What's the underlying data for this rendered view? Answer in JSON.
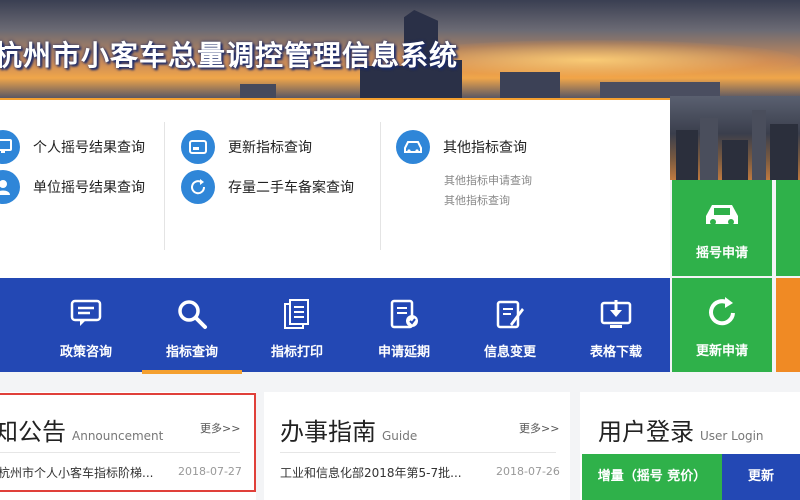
{
  "header": {
    "title": "杭州市小客车总量调控管理信息系统"
  },
  "query": {
    "col1": [
      {
        "label": "个人摇号结果查询",
        "icon": "monitor-icon"
      },
      {
        "label": "单位摇号结果查询",
        "icon": "user-icon"
      }
    ],
    "col2": [
      {
        "label": "更新指标查询",
        "icon": "card-icon"
      },
      {
        "label": "存量二手车备案查询",
        "icon": "refresh-icon"
      }
    ],
    "col3": {
      "label": "其他指标查询",
      "icon": "car-icon",
      "subs": [
        "其他指标申请查询",
        "其他指标查询"
      ]
    }
  },
  "nav": [
    {
      "label": "政策咨询",
      "icon": "chat-icon"
    },
    {
      "label": "指标查询",
      "icon": "search-icon",
      "active": true
    },
    {
      "label": "指标打印",
      "icon": "document-icon"
    },
    {
      "label": "申请延期",
      "icon": "form-edit-icon"
    },
    {
      "label": "信息变更",
      "icon": "edit-icon"
    },
    {
      "label": "表格下载",
      "icon": "download-icon"
    }
  ],
  "tiles": {
    "lottery": "摇号申请",
    "renew": "更新申请"
  },
  "announcement": {
    "title": "知公告",
    "sub": "Announcement",
    "more": "更多>>",
    "items": [
      {
        "text": "杭州市个人小客车指标阶梯...",
        "date": "2018-07-27"
      }
    ]
  },
  "guide": {
    "title": "办事指南",
    "sub": "Guide",
    "more": "更多>>",
    "items": [
      {
        "text": "工业和信息化部2018年第5-7批...",
        "date": "2018-07-26"
      }
    ]
  },
  "login": {
    "title": "用户登录",
    "sub": "User Login",
    "tab_active": "增量（摇号 竞价）",
    "tab_other": "更新"
  },
  "colors": {
    "nav_blue": "#2348b4",
    "accent_orange": "#f4a030",
    "tile_green": "#2fb14a",
    "icon_blue": "#2f86d8",
    "highlight_red": "#e0403a"
  }
}
